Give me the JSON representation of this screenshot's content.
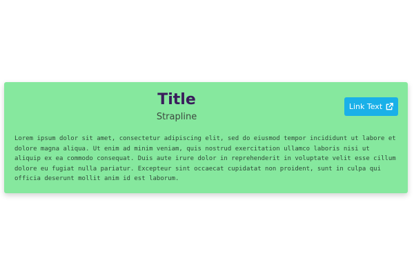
{
  "card": {
    "title": "Title",
    "strapline": "Strapline",
    "link_label": "Link Text",
    "link_icon": "external-link-icon",
    "body": "Lorem ipsum dolor sit amet, consectetur adipiscing elit, sed do eiusmod tempor incididunt ut labore et dolore magna aliqua. Ut enim ad minim veniam, quis nostrud exercitation ullamco laboris nisi ut aliquip ex ea commodo consequat. Duis aute irure dolor in reprehenderit in voluptate velit esse cillum dolore eu fugiat nulla pariatur. Excepteur sint occaecat cupidatat non proident, sunt in culpa qui officia deserunt mollit anim id est laborum."
  },
  "colors": {
    "card_background": "#86e89e",
    "title_text": "#3a1d5c",
    "strapline_text": "#3d4a40",
    "body_text": "#2f4a38",
    "button_background": "#1ab0e8",
    "button_text": "#ffffff"
  }
}
